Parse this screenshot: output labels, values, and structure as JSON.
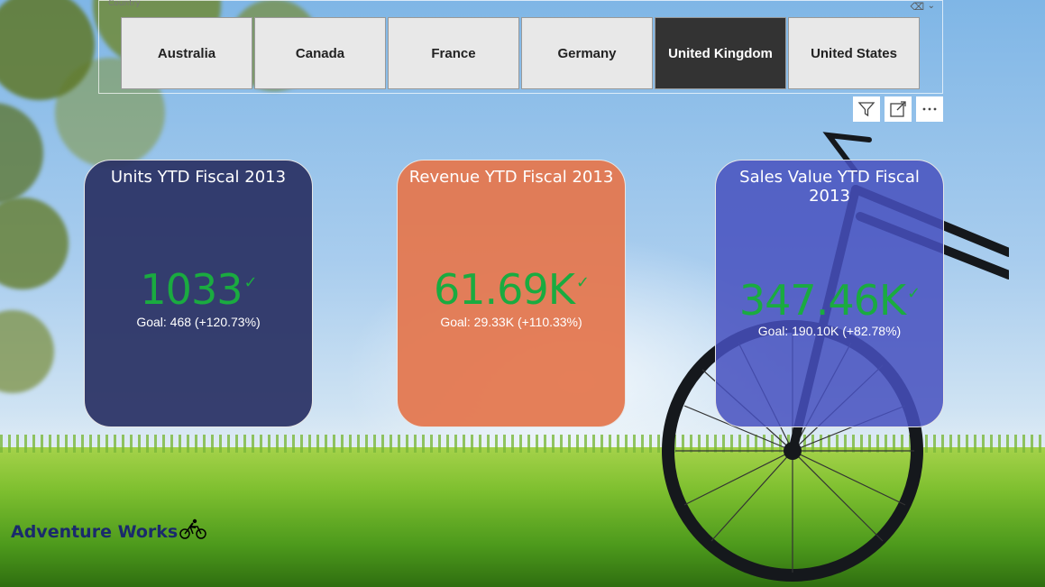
{
  "slicer": {
    "title": "Country",
    "options": [
      "Australia",
      "Canada",
      "France",
      "Germany",
      "United Kingdom",
      "United States"
    ],
    "selected": "United Kingdom"
  },
  "visual_header": {
    "icons": [
      "filter-icon",
      "focus-mode-icon",
      "more-options-icon"
    ]
  },
  "cards": {
    "units": {
      "title": "Units YTD Fiscal 2013",
      "value": "1033",
      "goal": "Goal: 468 (+120.73%)"
    },
    "revenue": {
      "title": "Revenue YTD Fiscal 2013",
      "value": "61.69K",
      "goal": "Goal: 29.33K (+110.33%)"
    },
    "sales": {
      "title": "Sales Value YTD Fiscal 2013",
      "value": "347.46K",
      "goal": "Goal: 190.10K (+82.78%)"
    }
  },
  "brand": {
    "name": "Adventure Works"
  },
  "colors": {
    "kpi_good": "#1aab40",
    "units_card": "#2a3264",
    "revenue_card": "#e47850",
    "sales_card": "#4650be",
    "slicer_selected": "#333333",
    "brand_text": "#1a2a6c"
  }
}
